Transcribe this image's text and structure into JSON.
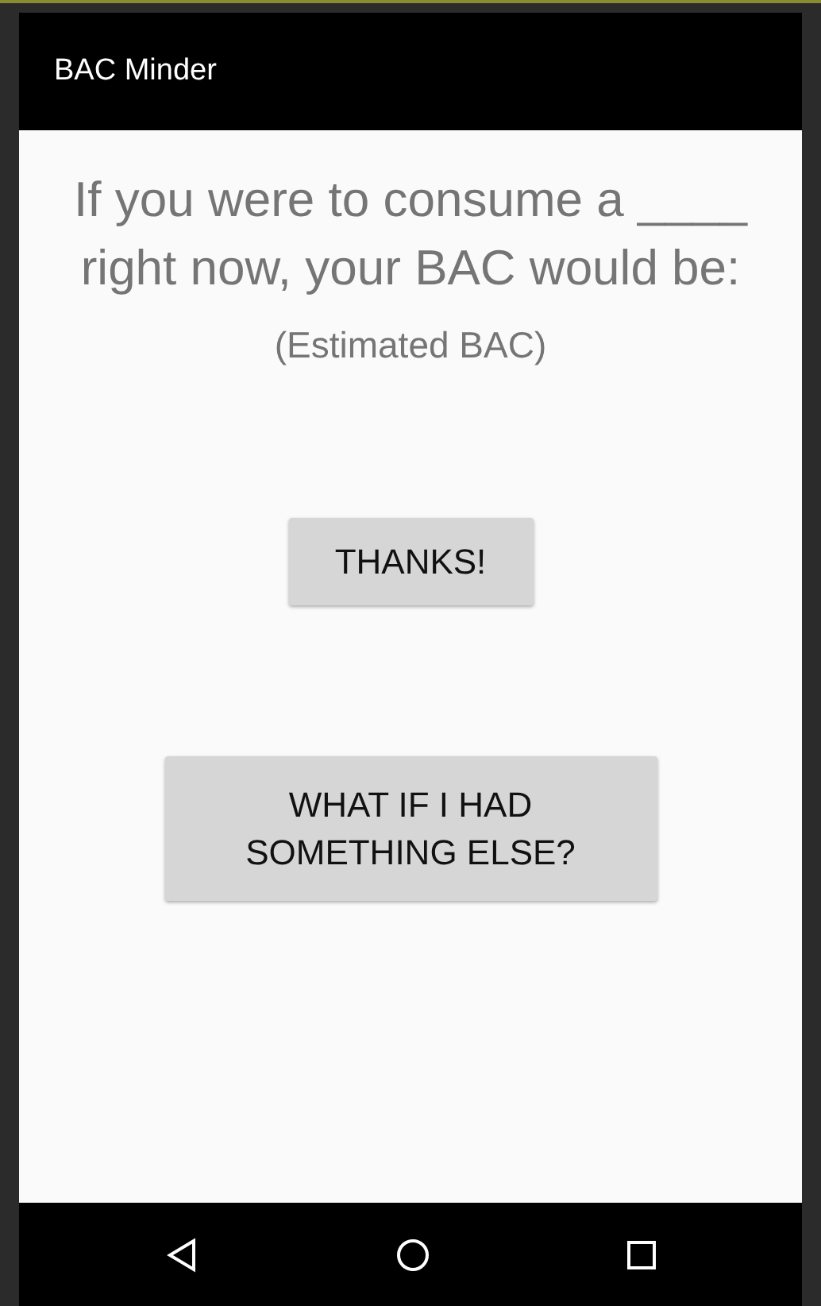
{
  "app_bar": {
    "title": "BAC Minder"
  },
  "prompt": "If you were to consume a ____ right now, your BAC would be:",
  "estimate": "(Estimated BAC)",
  "buttons": [
    {
      "label": "THANKS!"
    },
    {
      "label": "WHAT IF I HAD SOMETHING ELSE?"
    }
  ]
}
